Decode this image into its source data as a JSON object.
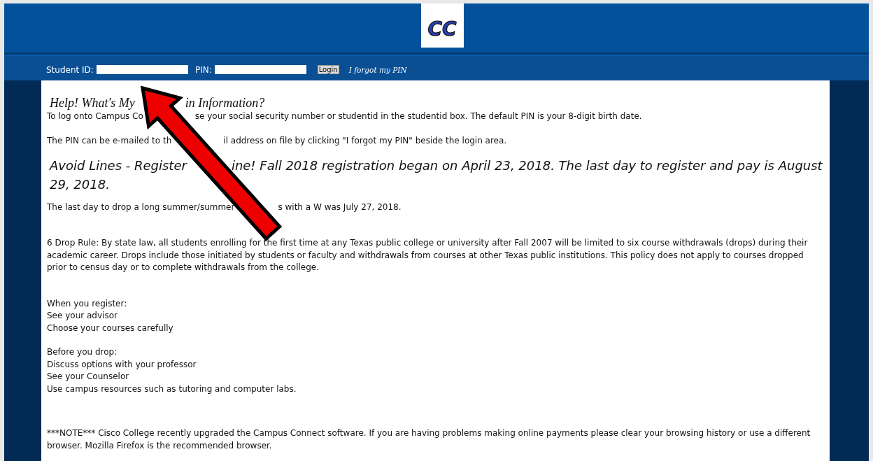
{
  "header": {
    "logo": {
      "text": "CC"
    }
  },
  "login_bar": {
    "student_id_label": "Student ID:",
    "pin_label": "PIN:",
    "login_button": "Login",
    "forgot_link": "I forgot my PIN"
  },
  "content": [
    {
      "kind": "heading",
      "parts": [
        "Help! What's My",
        "in Information?"
      ]
    },
    {
      "kind": "text",
      "parts": [
        "To log onto Campus Co",
        "se your social security number or studentid in the studentid box. The default PIN is your 8-digit birth date."
      ]
    },
    {
      "kind": "text",
      "parts": [
        "The PIN can be e-mailed to th",
        "il address on file by clicking \"I forgot my PIN\" beside the login area."
      ]
    },
    {
      "kind": "notice",
      "parts": [
        "Avoid Lines - Register",
        "ine! Fall 2018 registration began on April 23, 2018. The last day to register and pay is August"
      ],
      "second_line": "29, 2018."
    },
    {
      "kind": "text",
      "parts": [
        "The last day to drop a long summer/summer",
        "s with a W was July 27, 2018."
      ]
    },
    {
      "kind": "text",
      "parts": [
        "6 Drop Rule: By state law, all students enrolling for the first time at any Texas public college or university after Fall 2007 will be limited to six course withdrawals (drops) during their academic career. Drops include those initiated by students or faculty and withdrawals from courses at other Texas public institutions. This policy does not apply to courses dropped prior to census day or to complete withdrawals from the college."
      ]
    },
    {
      "kind": "lines",
      "lines": [
        "When you register:",
        "See your advisor",
        "Choose your courses carefully"
      ]
    },
    {
      "kind": "lines",
      "lines": [
        "Before you drop:",
        "Discuss options with your professor",
        "See your Counselor",
        "Use campus resources such as tutoring and computer labs."
      ]
    },
    {
      "kind": "text",
      "parts": [
        "***NOTE*** Cisco College recently upgraded the Campus Connect software. If you are having problems making online payments please clear your browsing history or use a different browser. Mozilla Firefox is the recommended browser."
      ]
    }
  ]
}
